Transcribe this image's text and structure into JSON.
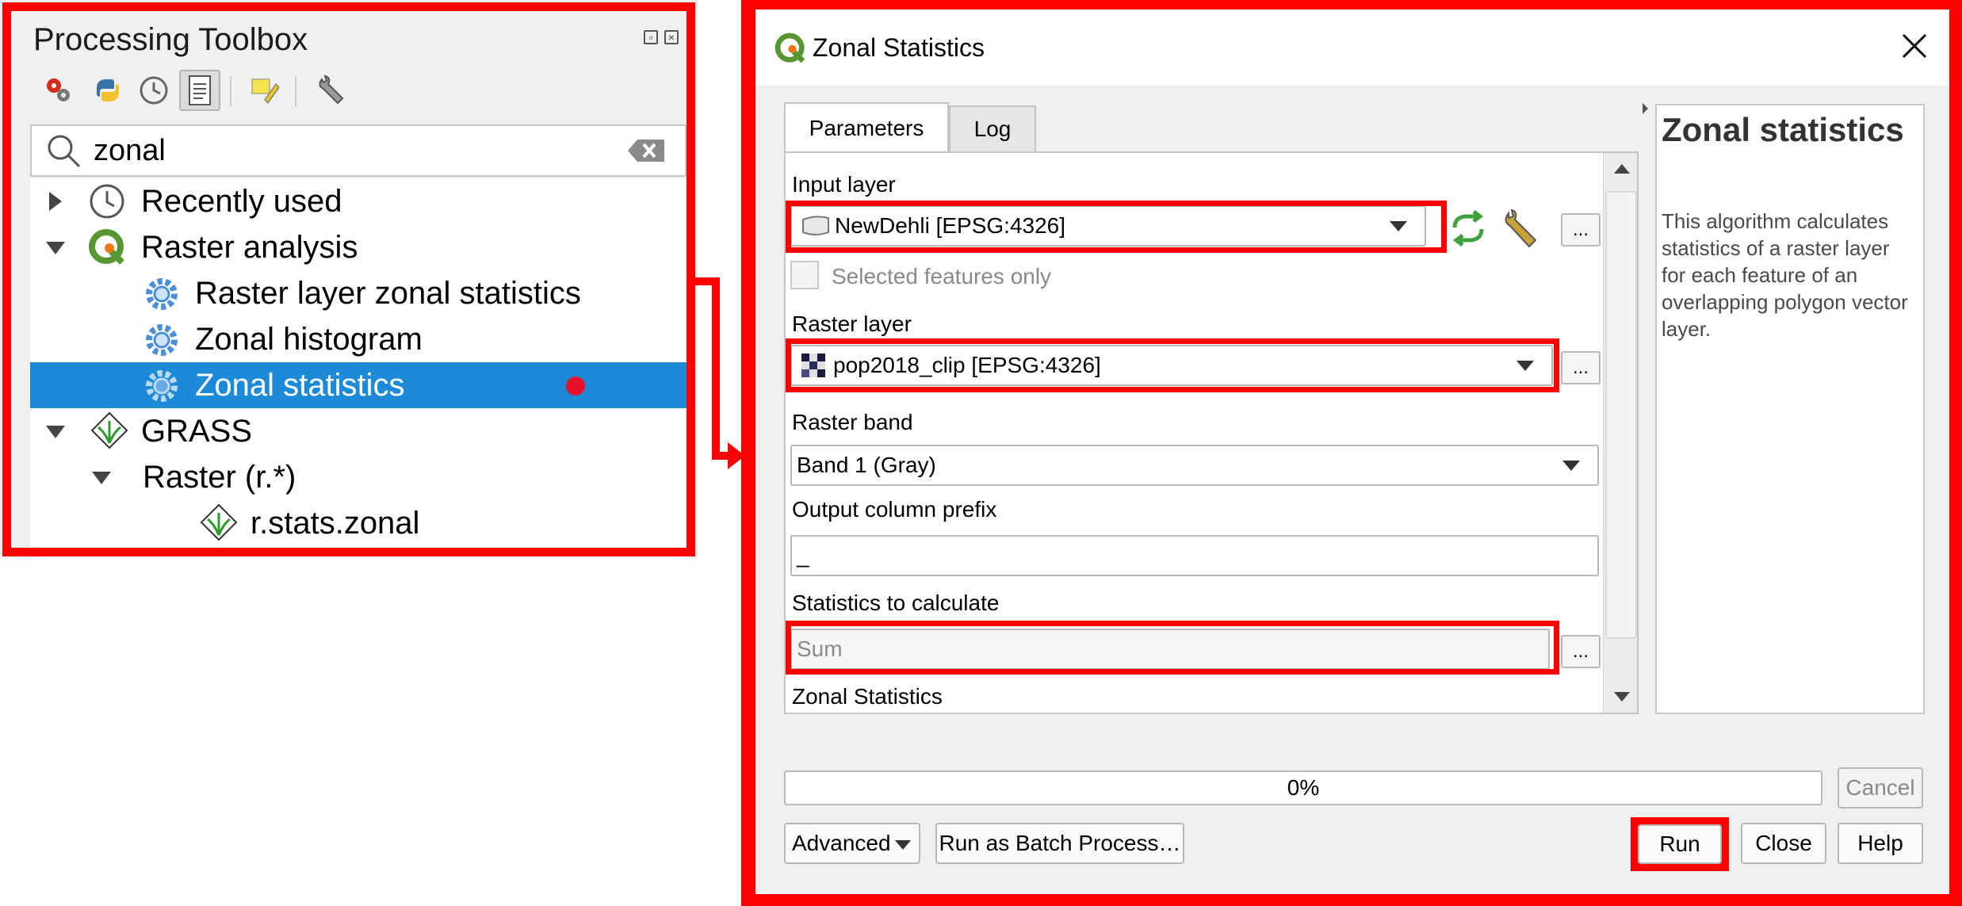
{
  "toolbox": {
    "title": "Processing Toolbox",
    "toolbar_icons": [
      "models-icon",
      "python-icon",
      "history-icon",
      "results-viewer-icon",
      "edit-features-icon",
      "options-wrench-icon"
    ],
    "search": {
      "value": "zonal"
    },
    "tree": [
      {
        "label": "Recently used",
        "icon": "clock-icon",
        "expanded": false
      },
      {
        "label": "Raster analysis",
        "icon": "qgis-logo-icon",
        "expanded": true
      },
      {
        "label": "Raster layer zonal statistics",
        "icon": "gear-icon"
      },
      {
        "label": "Zonal histogram",
        "icon": "gear-icon"
      },
      {
        "label": "Zonal statistics",
        "icon": "gear-icon",
        "selected": true
      },
      {
        "label": "GRASS",
        "icon": "grass-icon",
        "expanded": true
      },
      {
        "label": "Raster (r.*)",
        "expanded": true
      },
      {
        "label": "r.stats.zonal",
        "icon": "grass-icon"
      }
    ],
    "colors": {
      "selection": "#1c8ad6",
      "highlight": "#ff0000"
    }
  },
  "dialog": {
    "title": "Zonal Statistics",
    "tabs": [
      "Parameters",
      "Log"
    ],
    "params": {
      "input_layer_label": "Input layer",
      "input_layer_value": "NewDehli [EPSG:4326]",
      "selected_only_label": "Selected features only",
      "raster_layer_label": "Raster layer",
      "raster_layer_value": "pop2018_clip [EPSG:4326]",
      "raster_band_label": "Raster band",
      "raster_band_value": "Band 1 (Gray)",
      "prefix_label": "Output column prefix",
      "prefix_value": "_",
      "stats_label": "Statistics to calculate",
      "stats_value": "Sum",
      "output_label": "Zonal Statistics",
      "dots": "..."
    },
    "help": {
      "title": "Zonal statistics",
      "text": "This algorithm calculates statistics of a raster layer for each feature of an overlapping polygon vector layer."
    },
    "progress": {
      "value": 0,
      "text": "0%"
    },
    "buttons": {
      "cancel": "Cancel",
      "advanced": "Advanced",
      "batch": "Run as Batch Process…",
      "run": "Run",
      "close": "Close",
      "help": "Help"
    }
  }
}
